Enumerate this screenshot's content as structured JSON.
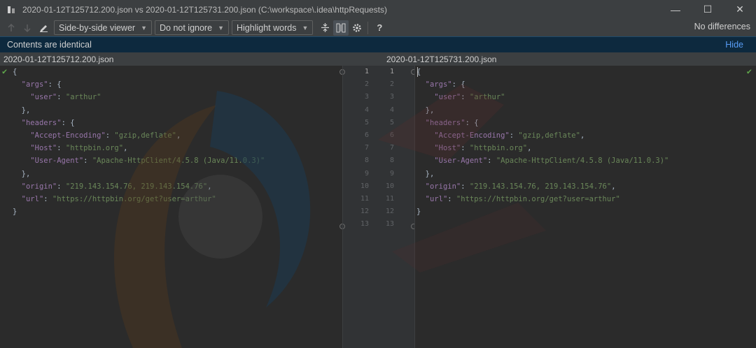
{
  "window": {
    "title": "2020-01-12T125712.200.json vs 2020-01-12T125731.200.json (C:\\workspace\\.idea\\httpRequests)",
    "minimize": "—",
    "maximize": "☐",
    "close": "✕"
  },
  "toolbar": {
    "viewer_label": "Side-by-side viewer",
    "ignore_label": "Do not ignore",
    "highlight_label": "Highlight words",
    "help_label": "?",
    "status": "No differences"
  },
  "infobar": {
    "message": "Contents are identical",
    "hide_label": "Hide"
  },
  "left_file": {
    "name": "2020-01-12T125712.200.json"
  },
  "right_file": {
    "name": "2020-01-12T125731.200.json"
  },
  "code_lines": [
    "{",
    "  \"args\": {",
    "    \"user\": \"arthur\"",
    "  },",
    "  \"headers\": {",
    "    \"Accept-Encoding\": \"gzip,deflate\",",
    "    \"Host\": \"httpbin.org\",",
    "    \"User-Agent\": \"Apache-HttpClient/4.5.8 (Java/11.0.3)\"",
    "  },",
    "  \"origin\": \"219.143.154.76, 219.143.154.76\",",
    "  \"url\": \"https://httpbin.org/get?user=arthur\"",
    "}",
    ""
  ],
  "line_numbers": [
    "1",
    "2",
    "3",
    "4",
    "5",
    "6",
    "7",
    "8",
    "9",
    "10",
    "11",
    "12",
    "13"
  ],
  "colors": {
    "accent_link": "#589df6",
    "info_bg": "#0d293e",
    "check": "#5fa74b",
    "json_key": "#9876aa",
    "json_string": "#6a8759"
  },
  "icons": [
    "prev-diff-icon",
    "next-diff-icon",
    "edit-icon",
    "collapse-icon",
    "sync-scroll-icon",
    "settings-icon",
    "help-icon",
    "checkmark-icon"
  ]
}
